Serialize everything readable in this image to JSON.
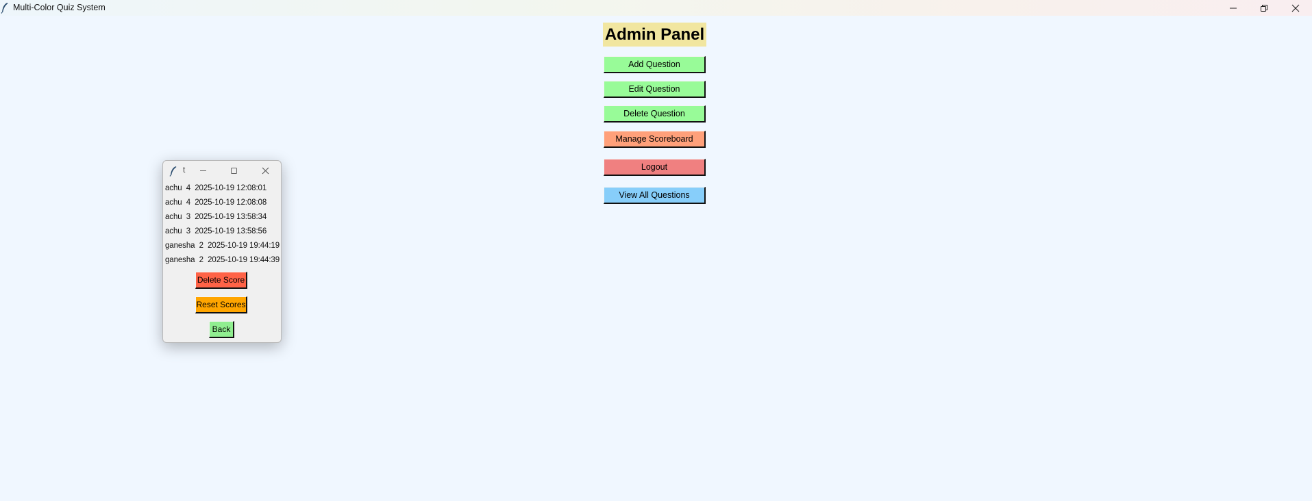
{
  "window": {
    "title": "Multi-Color Quiz System",
    "icons": {
      "app": "feather-icon",
      "minimize": "minimize-icon",
      "maximize": "restore-icon",
      "close": "close-icon"
    }
  },
  "admin": {
    "title": "Admin Panel",
    "title_bg": "#f1e6a0",
    "buttons": [
      {
        "label": "Add Question",
        "color": "#98fb98"
      },
      {
        "label": "Edit Question",
        "color": "#98fb98"
      },
      {
        "label": "Delete Question",
        "color": "#98fb98"
      },
      {
        "label": "Manage Scoreboard",
        "color": "#ffa07a"
      },
      {
        "label": "Logout",
        "color": "#f08080"
      },
      {
        "label": "View All Questions",
        "color": "#87cefa"
      }
    ]
  },
  "popup": {
    "title": "t",
    "scores": [
      {
        "name": "achu",
        "score": "4",
        "time": "2025-10-19 12:08:01"
      },
      {
        "name": "achu",
        "score": "4",
        "time": "2025-10-19 12:08:08"
      },
      {
        "name": "achu",
        "score": "3",
        "time": "2025-10-19 13:58:34"
      },
      {
        "name": "achu",
        "score": "3",
        "time": "2025-10-19 13:58:56"
      },
      {
        "name": "ganesha",
        "score": "2",
        "time": "2025-10-19 19:44:19"
      },
      {
        "name": "ganesha",
        "score": "2",
        "time": "2025-10-19 19:44:39"
      }
    ],
    "delete_label": "Delete Score",
    "delete_color": "#ff6347",
    "reset_label": "Reset Scores",
    "reset_color": "#ffa500",
    "back_label": "Back",
    "back_color": "#90ee90"
  }
}
